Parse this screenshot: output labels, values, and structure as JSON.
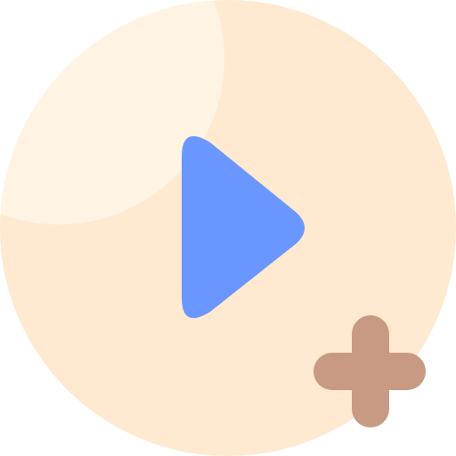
{
  "icon": {
    "name": "add-video-icon",
    "glyphs": [
      "circle-background",
      "highlight",
      "play-triangle",
      "plus-sign"
    ]
  },
  "colors": {
    "background_circle": "#ffe9d0",
    "highlight": "#fff3e4",
    "play": "#6997ff",
    "plus": "#c89a83"
  }
}
